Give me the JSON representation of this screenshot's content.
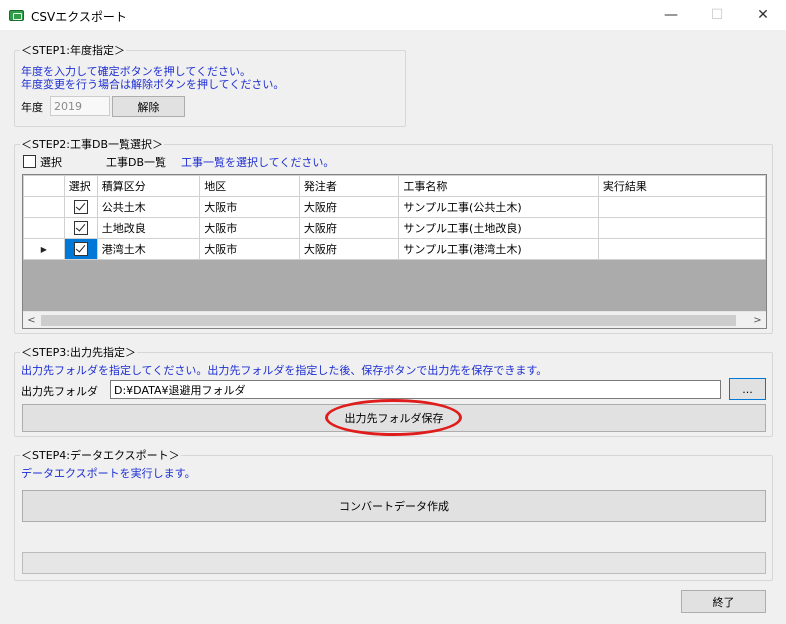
{
  "window": {
    "title": "CSVエクスポート",
    "minimize": "—",
    "maximize": "☐",
    "close": "✕",
    "app_icon": "csv-app-icon"
  },
  "step1": {
    "label": "＜STEP1:年度指定＞",
    "instruction_line1": "年度を入力して確定ボタンを押してください。",
    "instruction_line2": "年度変更を行う場合は解除ボタンを押してください。",
    "year_label": "年度",
    "year_value": "2019",
    "release_button": "解除"
  },
  "step2": {
    "label": "＜STEP2:工事DB一覧選択＞",
    "select_all_label": "選択",
    "list_label": "工事DB一覧",
    "instruction": "工事一覧を選択してください。",
    "columns": [
      "選択",
      "積算区分",
      "地区",
      "発注者",
      "工事名称",
      "実行結果"
    ],
    "rows": [
      {
        "checked": true,
        "category": "公共土木",
        "area": "大阪市",
        "client": "大阪府",
        "name": "サンプル工事(公共土木)",
        "result": ""
      },
      {
        "checked": true,
        "category": "土地改良",
        "area": "大阪市",
        "client": "大阪府",
        "name": "サンプル工事(土地改良)",
        "result": ""
      },
      {
        "checked": true,
        "category": "港湾土木",
        "area": "大阪市",
        "client": "大阪府",
        "name": "サンプル工事(港湾土木)",
        "result": "",
        "current": true
      }
    ],
    "current_row_marker": "▶",
    "scroll_left": "<",
    "scroll_right": ">"
  },
  "step3": {
    "label": "＜STEP3:出力先指定＞",
    "instruction": "出力先フォルダを指定してください。出力先フォルダを指定した後、保存ボタンで出力先を保存できます。",
    "folder_label": "出力先フォルダ",
    "folder_value": "D:¥DATA¥退避用フォルダ",
    "browse_button": "...",
    "save_button": "出力先フォルダ保存",
    "highlight_color": "#e01d1d"
  },
  "step4": {
    "label": "＜STEP4:データエクスポート＞",
    "instruction": "データエクスポートを実行します。",
    "convert_button": "コンバートデータ作成",
    "progress": 0
  },
  "footer": {
    "exit_button": "終了"
  },
  "colors": {
    "instruction_text": "#1d2ed2",
    "selection": "#0078d7",
    "grid_background": "#ababab"
  }
}
